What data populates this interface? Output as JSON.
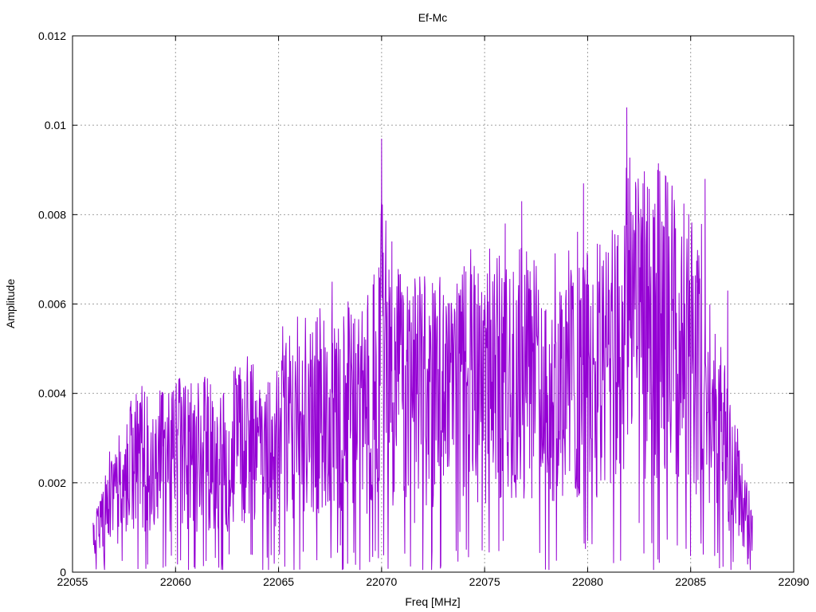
{
  "chart_data": {
    "type": "line",
    "title": "Ef-Mc",
    "xlabel": "Freq [MHz]",
    "ylabel": "Amplitude",
    "xlim": [
      22055,
      22090
    ],
    "ylim": [
      0,
      0.012
    ],
    "xticks": [
      22055,
      22060,
      22065,
      22070,
      22075,
      22080,
      22085,
      22090
    ],
    "xtick_labels": [
      "22055",
      "22060",
      "22065",
      "22070",
      "22075",
      "22080",
      "22085",
      "22090"
    ],
    "yticks": [
      0,
      0.002,
      0.004,
      0.006,
      0.008,
      0.01,
      0.012
    ],
    "ytick_labels": [
      "0",
      "0.002",
      "0.004",
      "0.006",
      "0.008",
      "0.01",
      "0.012"
    ],
    "grid": true,
    "series": [
      {
        "color": "#9400d3",
        "x": [
          22056.0,
          22056.5,
          22057.0,
          22057.5,
          22058.0,
          22058.5,
          22059.0,
          22059.5,
          22060.0,
          22060.5,
          22061.0,
          22061.5,
          22062.0,
          22062.5,
          22063.0,
          22063.5,
          22064.0,
          22064.5,
          22065.0,
          22065.5,
          22066.0,
          22066.5,
          22067.0,
          22067.5,
          22068.0,
          22068.5,
          22069.0,
          22069.5,
          22070.0,
          22070.5,
          22071.0,
          22071.5,
          22072.0,
          22072.5,
          22073.0,
          22073.5,
          22074.0,
          22074.5,
          22075.0,
          22075.5,
          22076.0,
          22076.5,
          22077.0,
          22077.5,
          22078.0,
          22078.5,
          22079.0,
          22079.5,
          22080.0,
          22080.5,
          22081.0,
          22081.5,
          22082.0,
          22082.5,
          22083.0,
          22083.5,
          22084.0,
          22084.5,
          22085.0,
          22085.5,
          22086.0,
          22086.5,
          22087.0,
          22087.5,
          22088.0
        ],
        "y": [
          0.0007,
          0.0012,
          0.0016,
          0.0021,
          0.0025,
          0.0026,
          0.0024,
          0.0025,
          0.0026,
          0.0027,
          0.0025,
          0.0027,
          0.0024,
          0.0025,
          0.0028,
          0.0029,
          0.0027,
          0.0026,
          0.0028,
          0.0033,
          0.0035,
          0.0034,
          0.0036,
          0.0035,
          0.0036,
          0.0037,
          0.0036,
          0.0037,
          0.0055,
          0.0042,
          0.004,
          0.0039,
          0.0041,
          0.004,
          0.0039,
          0.0038,
          0.0042,
          0.0043,
          0.0041,
          0.0045,
          0.0042,
          0.0043,
          0.0046,
          0.0042,
          0.004,
          0.0044,
          0.0042,
          0.0045,
          0.0044,
          0.0045,
          0.0046,
          0.0047,
          0.006,
          0.0052,
          0.0055,
          0.0057,
          0.0054,
          0.005,
          0.005,
          0.0048,
          0.0035,
          0.003,
          0.0024,
          0.0016,
          0.0008
        ],
        "peaks": [
          [
            22056.8,
            0.0027
          ],
          [
            22057.8,
            0.0037
          ],
          [
            22059.4,
            0.004
          ],
          [
            22060.1,
            0.0032
          ],
          [
            22061.4,
            0.0043
          ],
          [
            22062.9,
            0.0046
          ],
          [
            22065.2,
            0.0055
          ],
          [
            22067.6,
            0.0065
          ],
          [
            22070.0,
            0.0097
          ],
          [
            22070.5,
            0.0074
          ],
          [
            22073.0,
            0.0062
          ],
          [
            22076.0,
            0.0078
          ],
          [
            22076.8,
            0.0083
          ],
          [
            22079.8,
            0.0087
          ],
          [
            22081.9,
            0.0104
          ],
          [
            22083.4,
            0.009
          ],
          [
            22084.1,
            0.0086
          ],
          [
            22085.7,
            0.0088
          ],
          [
            22086.8,
            0.0063
          ]
        ],
        "dips": [
          [
            22059.4,
            0.0001
          ],
          [
            22062.1,
            0.0001
          ],
          [
            22062.6,
            0.0004
          ],
          [
            22068.0,
            0.0006
          ],
          [
            22071.6,
            0.0011
          ],
          [
            22073.8,
            0.0009
          ],
          [
            22075.9,
            0.0007
          ],
          [
            22080.0,
            0.0007
          ],
          [
            22082.5,
            0.0011
          ],
          [
            22087.8,
            0.0003
          ]
        ]
      }
    ]
  }
}
